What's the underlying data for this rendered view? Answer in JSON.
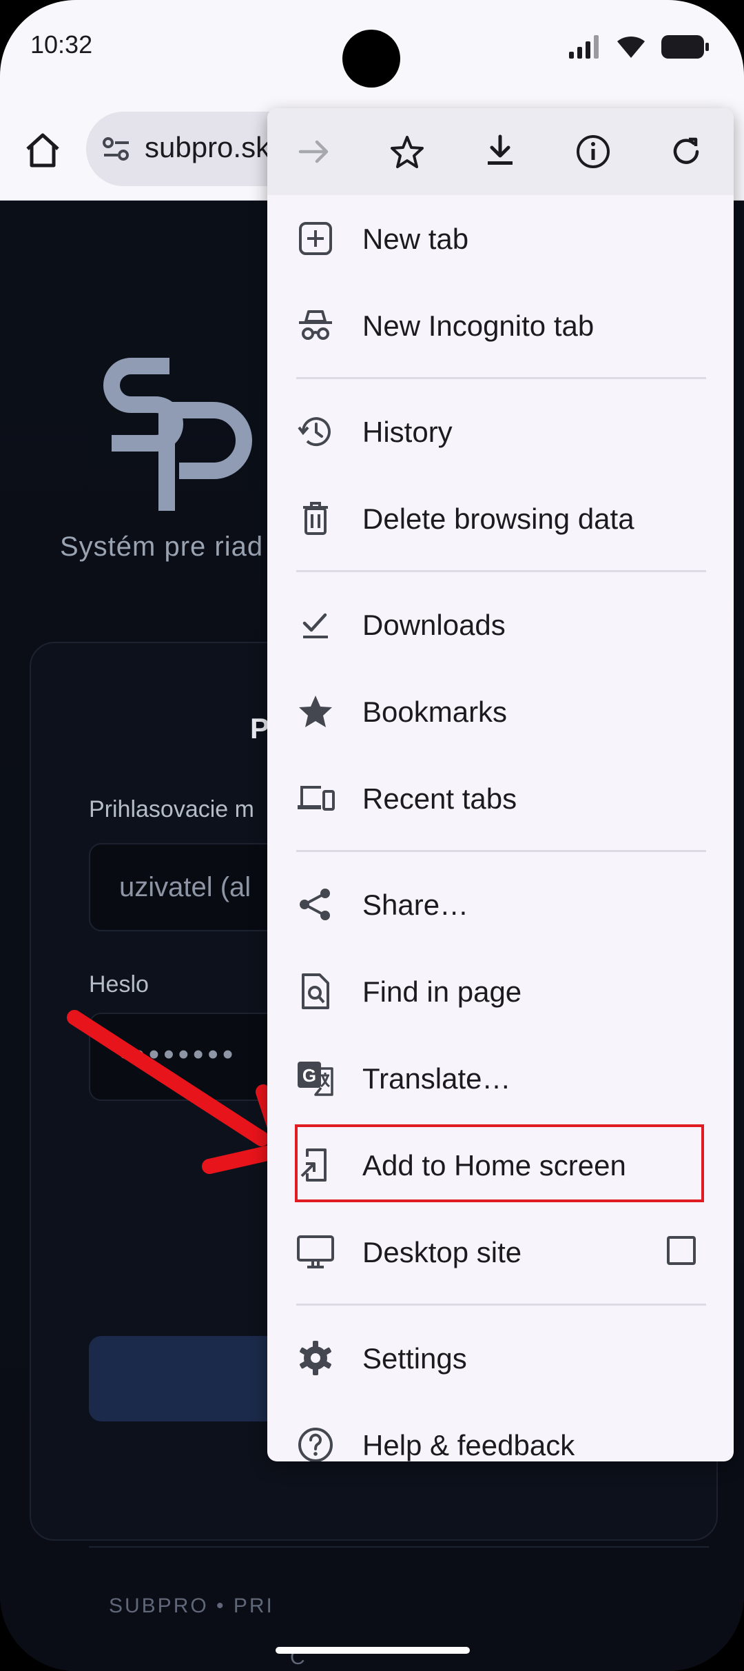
{
  "status_bar": {
    "time": "10:32"
  },
  "toolbar": {
    "url": "subpro.sk"
  },
  "page": {
    "tagline": "Systém pre riad",
    "card_title": "P",
    "username_label": "Prihlasovacie m",
    "username_placeholder": "uzivatel (al",
    "password_label": "Heslo",
    "password_value": "••••••••",
    "footer_line1": "SUBPRO • PRI",
    "footer_line2": "C"
  },
  "menu": {
    "items": [
      {
        "label": "New tab",
        "icon": "new-tab-icon"
      },
      {
        "label": "New Incognito tab",
        "icon": "incognito-icon"
      },
      {
        "label": "History",
        "icon": "history-icon"
      },
      {
        "label": "Delete browsing data",
        "icon": "trash-icon"
      },
      {
        "label": "Downloads",
        "icon": "downloads-check-icon"
      },
      {
        "label": "Bookmarks",
        "icon": "star-filled-icon"
      },
      {
        "label": "Recent tabs",
        "icon": "devices-icon"
      },
      {
        "label": "Share…",
        "icon": "share-icon"
      },
      {
        "label": "Find in page",
        "icon": "find-in-page-icon"
      },
      {
        "label": "Translate…",
        "icon": "translate-icon"
      },
      {
        "label": "Add to Home screen",
        "icon": "add-to-home-icon"
      },
      {
        "label": "Desktop site",
        "icon": "desktop-icon"
      },
      {
        "label": "Settings",
        "icon": "gear-icon"
      },
      {
        "label": "Help & feedback",
        "icon": "help-icon"
      }
    ],
    "highlight_color": "#e11b22",
    "desktop_site_checked": false
  },
  "colors": {
    "annotation_arrow": "#e8141b",
    "menu_bg": "#f7f5fb"
  }
}
